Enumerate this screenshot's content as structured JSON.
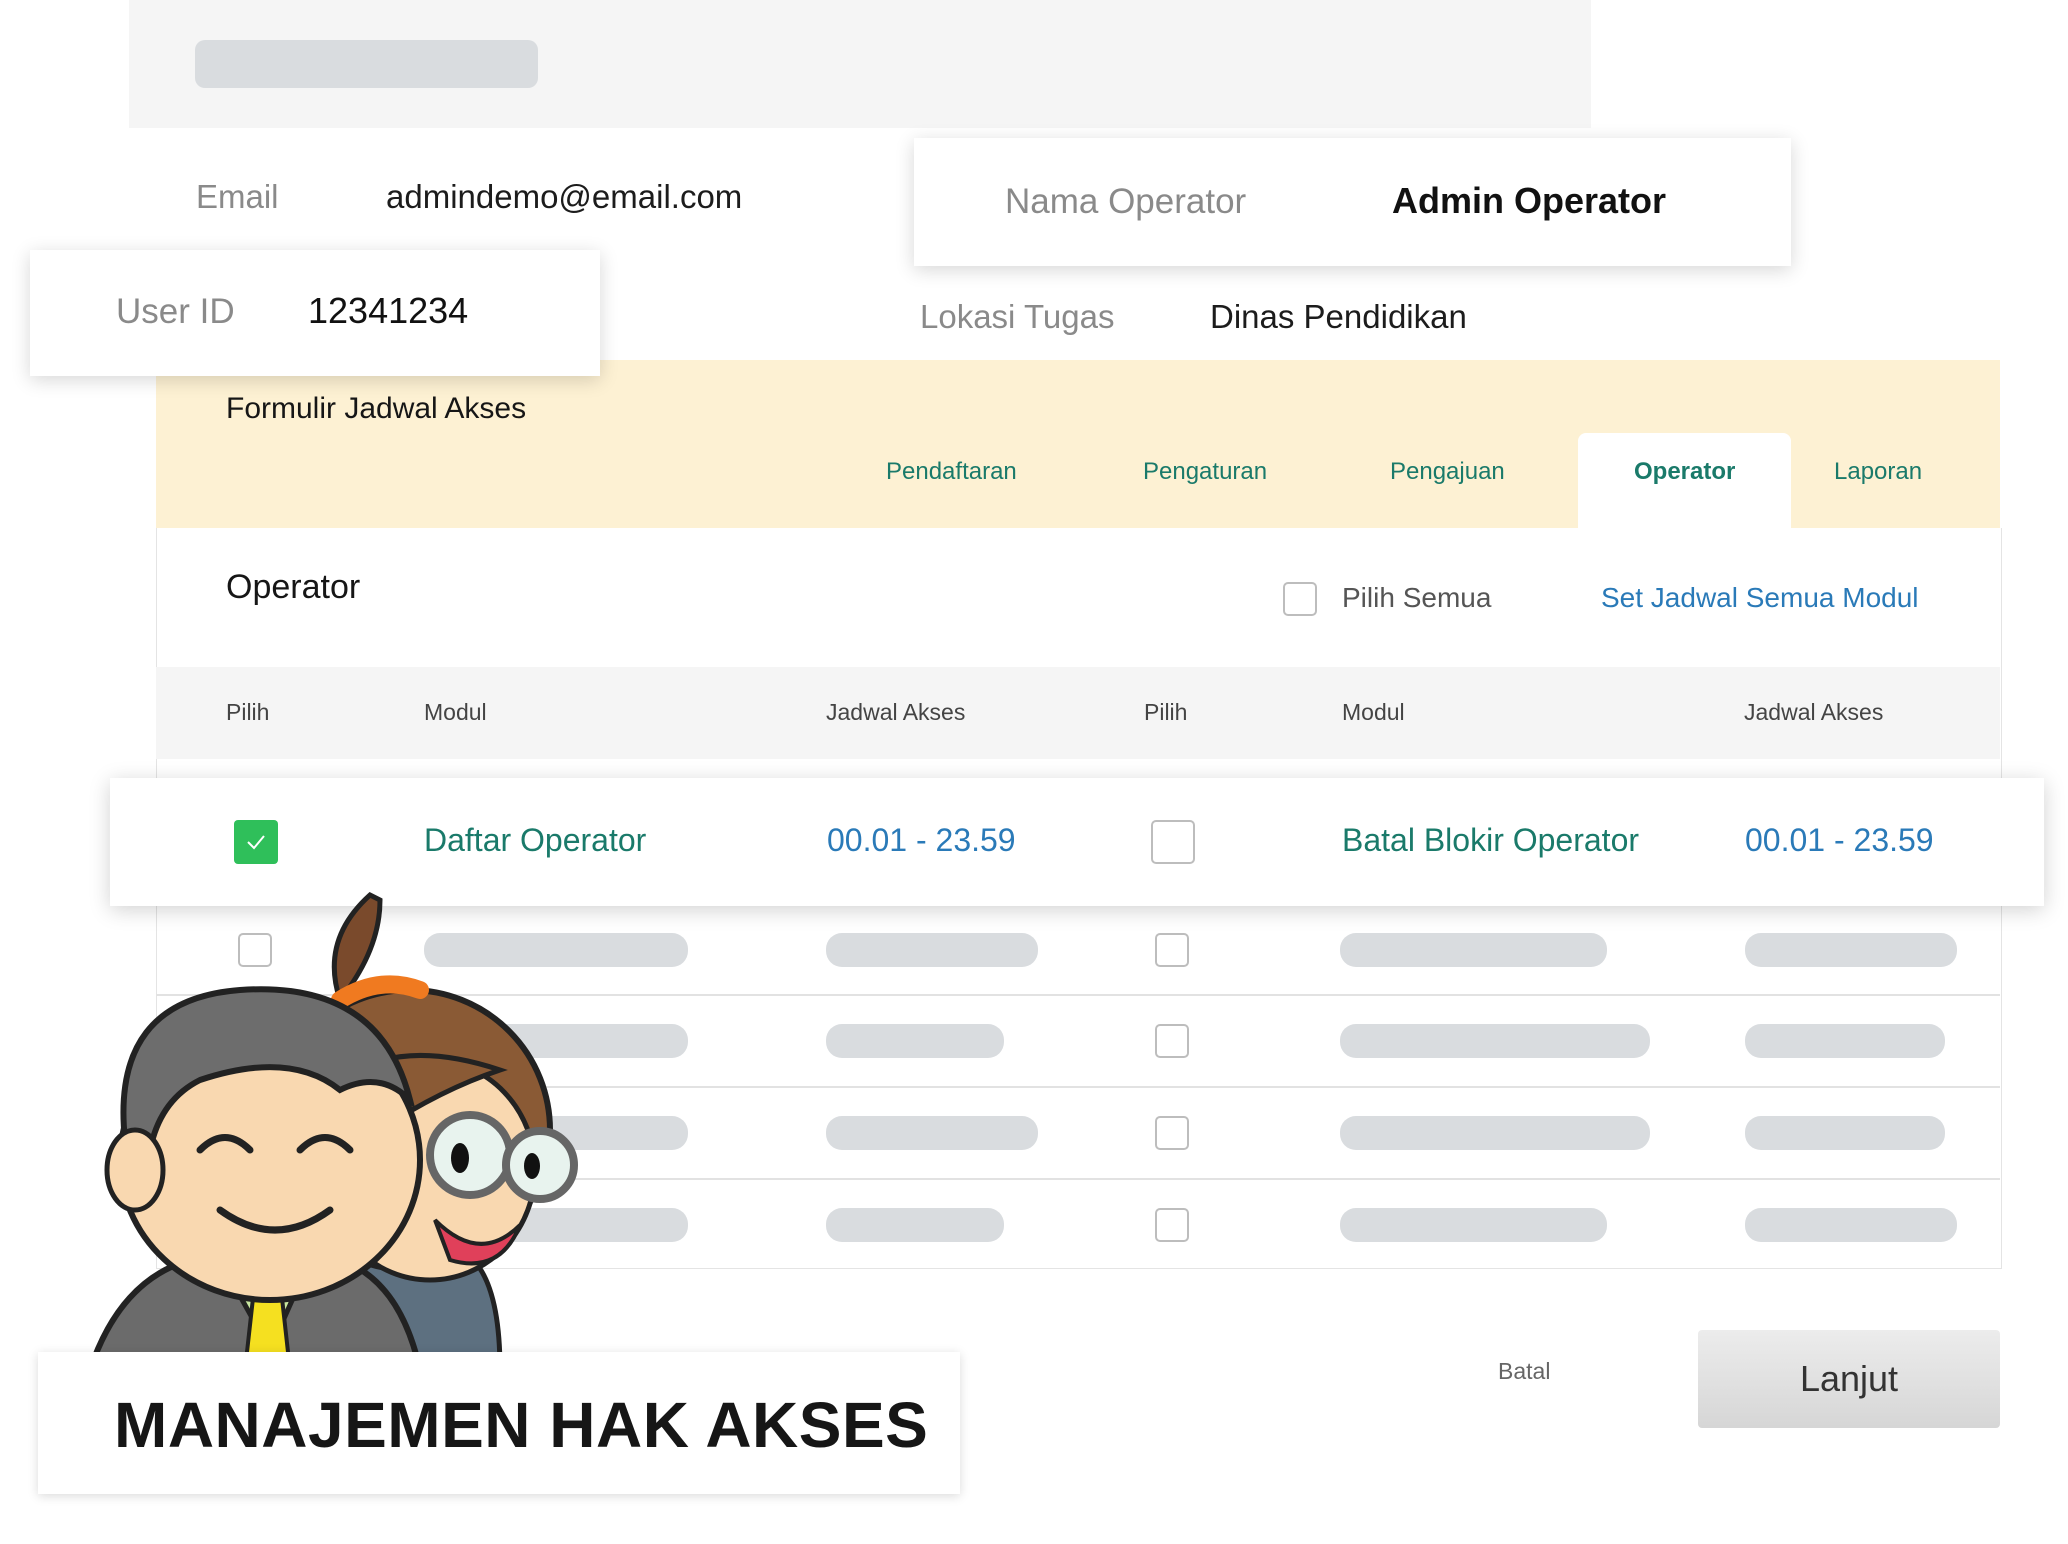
{
  "profile": {
    "email_label": "Email",
    "email_value": "admindemo@email.com",
    "user_id_label": "User ID",
    "user_id_value": "12341234",
    "operator_name_label": "Nama Operator",
    "operator_name_value": "Admin Operator",
    "location_label": "Lokasi Tugas",
    "location_value": "Dinas Pendidikan"
  },
  "form": {
    "title": "Formulir Jadwal Akses",
    "tabs": [
      {
        "label": "Pendaftaran",
        "active": false
      },
      {
        "label": "Pengaturan",
        "active": false
      },
      {
        "label": "Pengajuan",
        "active": false
      },
      {
        "label": "Operator",
        "active": true
      },
      {
        "label": "Laporan",
        "active": false
      }
    ],
    "section_title": "Operator",
    "select_all_label": "Pilih Semua",
    "set_all_link": "Set Jadwal Semua Modul",
    "columns": [
      "Pilih",
      "Modul",
      "Jadwal Akses",
      "Pilih",
      "Modul",
      "Jadwal Akses"
    ],
    "highlight_row": {
      "left": {
        "checked": true,
        "module": "Daftar Operator",
        "schedule": "00.01 - 23.59"
      },
      "right": {
        "checked": false,
        "module": "Batal Blokir Operator",
        "schedule": "00.01 - 23.59"
      }
    },
    "cancel_label": "Batal",
    "next_label": "Lanjut"
  },
  "banner": {
    "title": "MANAJEMEN HAK AKSES"
  },
  "colors": {
    "accent_teal": "#1a7a6a",
    "accent_blue": "#2a7ab8",
    "check_green": "#2fbf5a",
    "tab_bar_bg": "#fdf1d3"
  }
}
